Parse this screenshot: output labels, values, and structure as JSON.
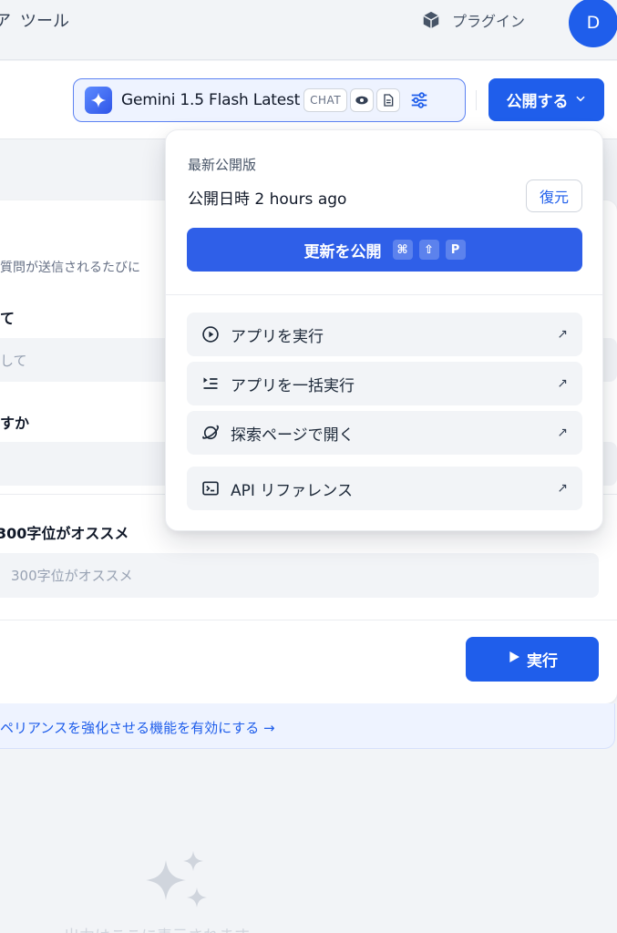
{
  "topbar": {
    "tools_icon": "ア",
    "tools_label": "ツール",
    "plugins_label": "プラグイン",
    "avatar_initial": "D"
  },
  "header": {
    "model_name": "Gemini 1.5 Flash Latest",
    "chat_badge": "CHAT",
    "publish_label": "公開する"
  },
  "form": {
    "description": "質問が送信されるたびに",
    "field1_label": "て",
    "field1_placeholder": "して",
    "field2_label": "すか",
    "field3_label": "300字位がオススメ",
    "field3_placeholder": "300字位がオススメ",
    "run_label": "実行",
    "feature_link": "ペリアンスを強化させる機能を有効にする →"
  },
  "output": {
    "placeholder": "出力はここに表示されます"
  },
  "dropdown": {
    "section_title": "最新公開版",
    "published_at": "公開日時 2 hours ago",
    "restore_label": "復元",
    "update_publish_label": "更新を公開",
    "shortcut_keys": [
      "⌘",
      "⇧",
      "P"
    ],
    "items": [
      {
        "label": "アプリを実行",
        "icon": "play-circle-icon"
      },
      {
        "label": "アプリを一括実行",
        "icon": "batch-run-icon"
      },
      {
        "label": "探索ページで開く",
        "icon": "planet-icon"
      },
      {
        "label": "API リファレンス",
        "icon": "terminal-icon"
      }
    ],
    "item_arrow": "↗"
  },
  "colors": {
    "accent": "#1f5eeb",
    "background": "#f2f4f7",
    "surface": "#ffffff"
  }
}
